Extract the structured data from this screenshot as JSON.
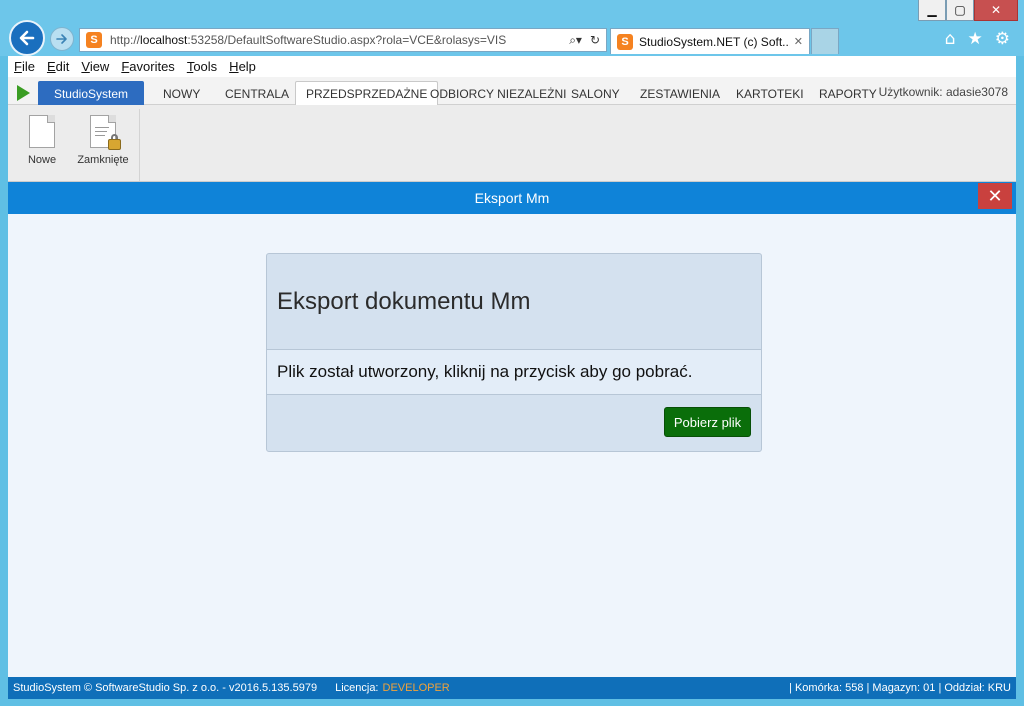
{
  "browser": {
    "url_prefix": "http://",
    "url_host": "localhost",
    "url_rest": ":53258/DefaultSoftwareStudio.aspx?rola=VCE&rolasys=VIS",
    "tab_title": "StudioSystem.NET (c) Soft...",
    "site_logo_letter": "S"
  },
  "menu": [
    {
      "label": "File"
    },
    {
      "label": "Edit"
    },
    {
      "label": "View"
    },
    {
      "label": "Favorites"
    },
    {
      "label": "Tools"
    },
    {
      "label": "Help"
    }
  ],
  "appnav": {
    "brand": "StudioSystem",
    "items": [
      "NOWY",
      "CENTRALA",
      "PRZEDSPRZEDAŻNE",
      "ODBIORCY NIEZALEŻNI",
      "SALONY",
      "ZESTAWIENIA",
      "KARTOTEKI",
      "RAPORTY"
    ],
    "active_index": 2,
    "user_label": "Użytkownik: adasie3078"
  },
  "ribbon": {
    "new_label": "Nowe",
    "closed_label": "Zamknięte"
  },
  "dialog": {
    "title": "Eksport Mm",
    "close_symbol": "✕"
  },
  "panel": {
    "heading": "Eksport dokumentu Mm",
    "message": "Plik został utworzony, kliknij na przycisk aby go pobrać.",
    "button_label": "Pobierz plik"
  },
  "status": {
    "copyright": "StudioSystem © SoftwareStudio Sp. z o.o. - v2016.5.135.5979",
    "license_label": "Licencja:",
    "license_value": "DEVELOPER",
    "right_info": "| Komórka: 558 | Magazyn: 01 | Oddział: KRU"
  },
  "colors": {
    "accent_blue": "#0f83d8",
    "button_green": "#0a6e0a",
    "license_orange": "#f0a23a"
  }
}
